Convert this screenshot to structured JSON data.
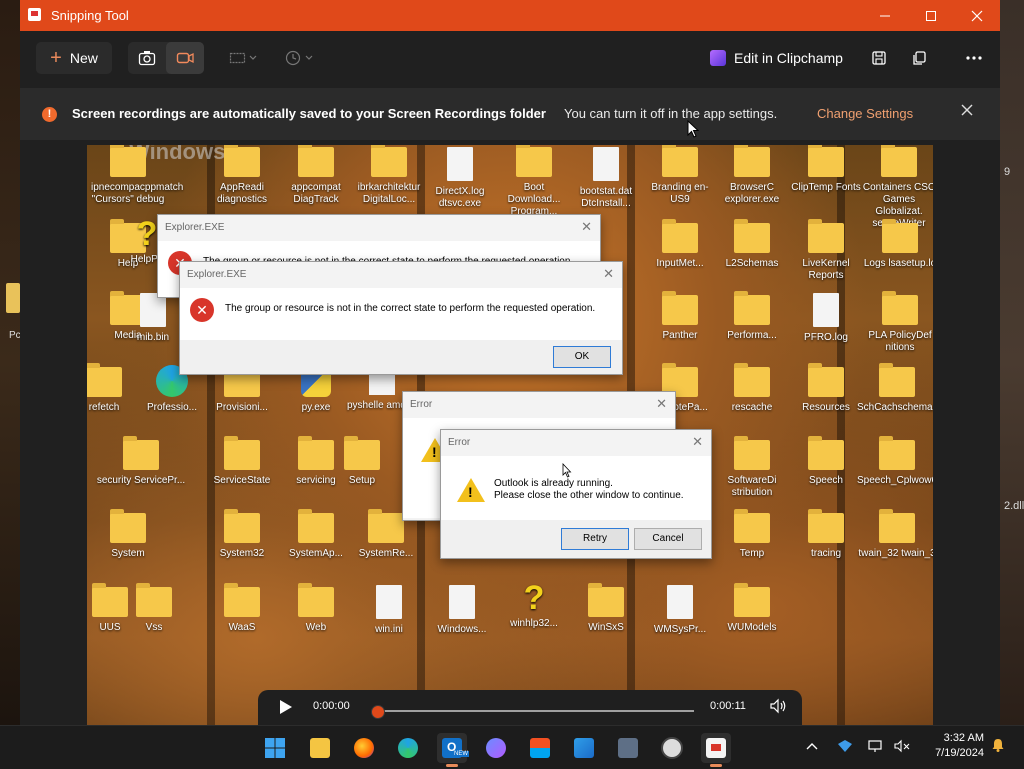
{
  "window": {
    "title": "Snipping Tool"
  },
  "toolbar": {
    "new_label": "New",
    "clipchamp_label": "Edit in Clipchamp"
  },
  "banner": {
    "bold_text": "Screen recordings are automatically saved to your Screen Recordings folder",
    "text": "You can turn it off in the app settings.",
    "link": "Change Settings"
  },
  "video": {
    "watermark": "Windows",
    "icons": [
      {
        "label": "ipnecompacppmatch \"Cursors\" debug"
      },
      {
        "label": "AppReadi diagnostics"
      },
      {
        "label": "appcompat DiagTrack"
      },
      {
        "label": "ibrkarchitektur DigitalLoc..."
      },
      {
        "label": "DirectX.log dtsvc.exe"
      },
      {
        "label": "Boot Download... Program..."
      },
      {
        "label": "bootstat.dat DtcInstall..."
      },
      {
        "label": "Branding en-US9"
      },
      {
        "label": "BrowserC explorer.exe"
      },
      {
        "label": "ClipTemp Fonts"
      },
      {
        "label": "Containers CSC Games Globalizat. senceWriter"
      },
      {
        "label": "Help"
      },
      {
        "label": "HelpPa"
      },
      {
        "label": "InputMet..."
      },
      {
        "label": "L2Schemas"
      },
      {
        "label": "LiveKernel Reports"
      },
      {
        "label": "Logs lsasetup.lo"
      },
      {
        "label": "Media"
      },
      {
        "label": "mib.bin"
      },
      {
        "label": "Panther"
      },
      {
        "label": "Performa..."
      },
      {
        "label": "PFRO.log"
      },
      {
        "label": "PLA PolicyDef nitions"
      },
      {
        "label": "refetch"
      },
      {
        "label": "Professio..."
      },
      {
        "label": "Provisioni..."
      },
      {
        "label": "py.exe"
      },
      {
        "label": "pyshelle amd64"
      },
      {
        "label": "RemotePa..."
      },
      {
        "label": "rescache"
      },
      {
        "label": "Resources"
      },
      {
        "label": "SchCachschemas"
      },
      {
        "label": "security ServicePr..."
      },
      {
        "label": "ServiceState"
      },
      {
        "label": "servicing"
      },
      {
        "label": "Setup"
      },
      {
        "label": "SoftwareDi stribution"
      },
      {
        "label": "Speech"
      },
      {
        "label": "Speech_Cplwow64"
      },
      {
        "label": "System"
      },
      {
        "label": "System32"
      },
      {
        "label": "SystemAp..."
      },
      {
        "label": "SystemRe..."
      },
      {
        "label": "Temp"
      },
      {
        "label": "tracing"
      },
      {
        "label": "twain_32 twain_3"
      },
      {
        "label": "UUS"
      },
      {
        "label": "Vss"
      },
      {
        "label": "WaaS"
      },
      {
        "label": "Web"
      },
      {
        "label": "win.ini"
      },
      {
        "label": "Windows..."
      },
      {
        "label": "winhlp32..."
      },
      {
        "label": "WinSxS"
      },
      {
        "label": "WMSysPr..."
      },
      {
        "label": "WUModels"
      }
    ]
  },
  "dialogs": {
    "explorer_back": {
      "title": "Explorer.EXE",
      "message": "The group or resource is not in the correct state to perform the requested operation."
    },
    "explorer_front": {
      "title": "Explorer.EXE",
      "message": "The group or resource is not in the correct state to perform the requested operation.",
      "ok": "OK"
    },
    "error_back": {
      "title": "Error"
    },
    "error_front": {
      "title": "Error",
      "line1": "Outlook is already running.",
      "line2": "Please close the other window to continue.",
      "retry": "Retry",
      "cancel": "Cancel"
    }
  },
  "player": {
    "current_time": "0:00:00",
    "total_time": "0:00:11",
    "progress": 0.0
  },
  "taskbar": {
    "time": "3:32 AM",
    "date": "7/19/2024",
    "outlook_badge": "NEW"
  },
  "background": {
    "right_fragments": [
      "9",
      "2.dll"
    ],
    "left_fragment": "Pc"
  },
  "colors": {
    "titlebar": "#e0491a",
    "accent": "#f0a070",
    "info_icon": "#f06a2d",
    "error_icon": "#d8352a",
    "warning_icon": "#f2c01c"
  }
}
